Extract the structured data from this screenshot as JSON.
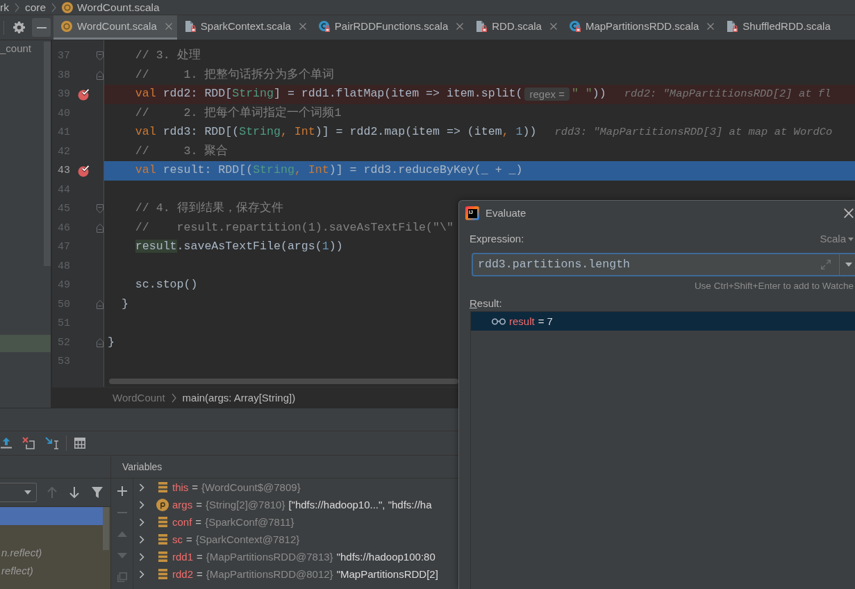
{
  "breadcrumb": {
    "segments": [
      "rk",
      "core"
    ],
    "file": "WordCount.scala"
  },
  "tabs": [
    {
      "label": "WordCount.scala",
      "kind": "object",
      "selected": true,
      "closable": true
    },
    {
      "label": "SparkContext.scala",
      "kind": "file",
      "selected": false,
      "closable": true
    },
    {
      "label": "PairRDDFunctions.scala",
      "kind": "class",
      "selected": false,
      "closable": true
    },
    {
      "label": "RDD.scala",
      "kind": "file",
      "selected": false,
      "closable": true
    },
    {
      "label": "MapPartitionsRDD.scala",
      "kind": "class",
      "selected": false,
      "closable": true
    },
    {
      "label": "ShuffledRDD.scala",
      "kind": "file",
      "selected": false,
      "closable": false
    }
  ],
  "project_panel": {
    "items": [
      "_count"
    ]
  },
  "editor": {
    "lines": [
      {
        "number": "37",
        "fold": {
          "kind": "start"
        },
        "breakpoint": false,
        "current": false,
        "tokens": [
          {
            "kind": "comment",
            "text": "    // 3. 处理"
          }
        ]
      },
      {
        "number": "38",
        "fold": {
          "kind": "end"
        },
        "breakpoint": false,
        "current": false,
        "tokens": [
          {
            "kind": "comment",
            "text": "    //     1. 把整句话拆分为多个单词"
          }
        ]
      },
      {
        "number": "39",
        "breakpoint": true,
        "current": false,
        "tokens": [
          {
            "kind": "keyword",
            "text": "    val"
          },
          {
            "kind": "plain",
            "text": " rdd2: RDD["
          },
          {
            "kind": "type",
            "text": "String"
          },
          {
            "kind": "plain",
            "text": "] = rdd1.flatMap(item => item.split("
          },
          {
            "kind": "param_hint",
            "text": "regex ="
          },
          {
            "kind": "string",
            "text": "\" \""
          },
          {
            "kind": "plain",
            "text": "))"
          },
          {
            "kind": "value_hint",
            "text": "rdd2: \"MapPartitionsRDD[2] at fl"
          }
        ]
      },
      {
        "number": "40",
        "breakpoint": false,
        "current": false,
        "tokens": [
          {
            "kind": "comment",
            "text": "    //     2. 把每个单词指定一个词频1"
          }
        ]
      },
      {
        "number": "41",
        "breakpoint": false,
        "current": false,
        "tokens": [
          {
            "kind": "keyword",
            "text": "    val"
          },
          {
            "kind": "plain",
            "text": " rdd3: RDD[("
          },
          {
            "kind": "type",
            "text": "String"
          },
          {
            "kind": "keyword",
            "text": ", Int"
          },
          {
            "kind": "plain",
            "text": ")] = rdd2.map(item => (item"
          },
          {
            "kind": "keyword",
            "text": ", "
          },
          {
            "kind": "number",
            "text": "1"
          },
          {
            "kind": "plain",
            "text": "))"
          },
          {
            "kind": "value_hint",
            "text": "rdd3: \"MapPartitionsRDD[3] at map at WordCo"
          }
        ]
      },
      {
        "number": "42",
        "breakpoint": false,
        "current": false,
        "tokens": [
          {
            "kind": "comment",
            "text": "    //     3. 聚合"
          }
        ]
      },
      {
        "number": "43",
        "breakpoint": true,
        "current": true,
        "tokens": [
          {
            "kind": "keyword",
            "text": "    val"
          },
          {
            "kind": "plain",
            "text": " result: RDD[("
          },
          {
            "kind": "type",
            "text": "String"
          },
          {
            "kind": "keyword",
            "text": ", Int"
          },
          {
            "kind": "plain",
            "text": ")] = rdd3.reduceByKey(_ + _)"
          }
        ]
      },
      {
        "number": "44",
        "breakpoint": false,
        "current": false
      },
      {
        "number": "45",
        "fold": {
          "kind": "start"
        },
        "breakpoint": false,
        "current": false,
        "tokens": [
          {
            "kind": "comment",
            "text": "    // 4. 得到结果，保存文件"
          }
        ]
      },
      {
        "number": "46",
        "fold": {
          "kind": "end"
        },
        "breakpoint": false,
        "current": false,
        "tokens": [
          {
            "kind": "comment",
            "text": "    //    result.repartition(1).saveAsTextFile(\"\\\""
          }
        ]
      },
      {
        "number": "47",
        "breakpoint": false,
        "current": false,
        "tokens": [
          {
            "kind": "usage",
            "text": "    result"
          },
          {
            "kind": "plain",
            "text": ".saveAsTextFile(args("
          },
          {
            "kind": "number",
            "text": "1"
          },
          {
            "kind": "plain",
            "text": "))"
          }
        ]
      },
      {
        "number": "48",
        "breakpoint": false,
        "current": false
      },
      {
        "number": "49",
        "breakpoint": false,
        "current": false,
        "tokens": [
          {
            "kind": "plain",
            "text": "    sc.stop()"
          }
        ]
      },
      {
        "number": "50",
        "fold": {
          "kind": "end"
        },
        "breakpoint": false,
        "current": false,
        "tokens": [
          {
            "kind": "plain",
            "text": "  }"
          }
        ]
      },
      {
        "number": "51",
        "breakpoint": false,
        "current": false
      },
      {
        "number": "52",
        "fold": {
          "kind": "end"
        },
        "breakpoint": false,
        "current": false,
        "tokens": [
          {
            "kind": "plain",
            "text": "}"
          }
        ]
      },
      {
        "number": "53",
        "breakpoint": false,
        "current": false
      }
    ],
    "footer": {
      "class": "WordCount",
      "method": "main(args: Array[String])"
    }
  },
  "debugger": {
    "frame_controls": [
      {
        "kind": "up",
        "disabled": true
      },
      {
        "kind": "down",
        "disabled": false
      },
      {
        "kind": "filter",
        "disabled": false
      }
    ],
    "frames": [
      {
        "selected": true
      },
      {
        "selected": false
      },
      {
        "label": "n.reflect)",
        "selected": false
      },
      {
        "label": "reflect)",
        "selected": false
      }
    ],
    "variables_title": "Variables",
    "variable_controls": [
      {
        "kind": "add",
        "disabled": false
      },
      {
        "kind": "remove",
        "disabled": true
      },
      {
        "kind": "move_up",
        "disabled": true
      },
      {
        "kind": "move_down",
        "disabled": true
      },
      {
        "kind": "copy",
        "disabled": true
      }
    ],
    "variables": [
      {
        "name": "this",
        "kind": "field",
        "expanded": false,
        "operator": "=",
        "ref": "{WordCount$@7809}"
      },
      {
        "name": "args",
        "kind": "parameter",
        "expanded": false,
        "operator": "=",
        "ref": "{String[2]@7810}",
        "value": "[\"hdfs://hadoop10...\", \"hdfs://ha"
      },
      {
        "name": "conf",
        "kind": "field",
        "expanded": false,
        "operator": "=",
        "ref": "{SparkConf@7811}"
      },
      {
        "name": "sc",
        "kind": "field",
        "expanded": false,
        "operator": "=",
        "ref": "{SparkContext@7812}"
      },
      {
        "name": "rdd1",
        "kind": "field",
        "expanded": false,
        "operator": "=",
        "ref": "{MapPartitionsRDD@7813}",
        "value": "\"hdfs://hadoop100:80"
      },
      {
        "name": "rdd2",
        "kind": "field",
        "expanded": false,
        "operator": "=",
        "ref": "{MapPartitionsRDD@8012}",
        "value": "\"MapPartitionsRDD[2]"
      }
    ]
  },
  "evaluate_dialog": {
    "logo": "IJ",
    "title": "Evaluate",
    "expression_label": "Expression:",
    "language": "Scala",
    "expression": "rdd3.partitions.length",
    "hint": "Use Ctrl+Shift+Enter to add to Watche",
    "result_label": "Result:",
    "results": [
      {
        "name": "result",
        "value": "= 7",
        "selected": true
      }
    ]
  }
}
